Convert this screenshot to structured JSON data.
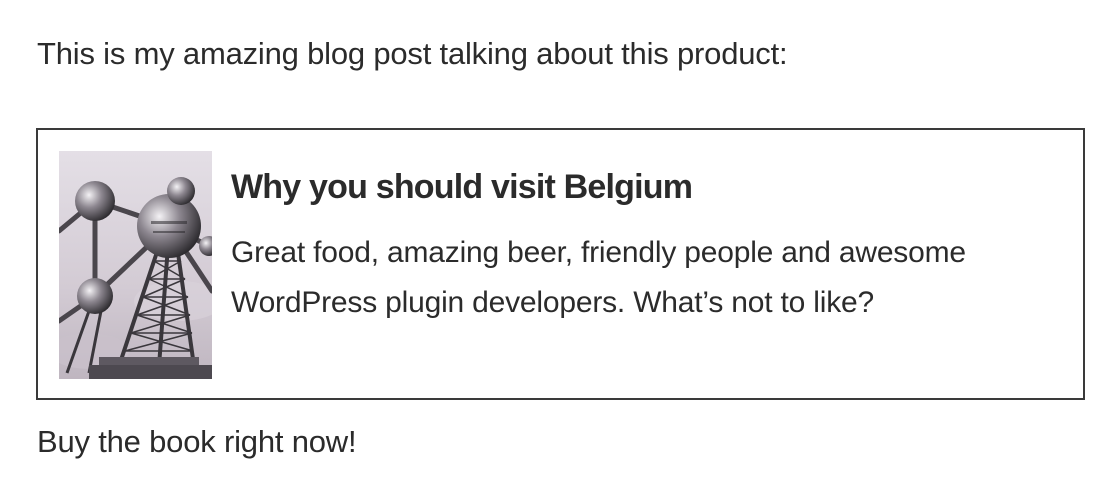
{
  "post": {
    "intro_text": "This is my amazing blog post talking about this product:",
    "outro_text": "Buy the book right now!"
  },
  "card": {
    "title": "Why you should visit Belgium",
    "description": "Great food, amazing beer, friendly people and awesome WordPress plugin developers. What’s not to like?",
    "image_subject": "atomium-photo"
  },
  "colors": {
    "text": "#2b2b2b",
    "border": "#3a3a3a",
    "background": "#ffffff"
  }
}
